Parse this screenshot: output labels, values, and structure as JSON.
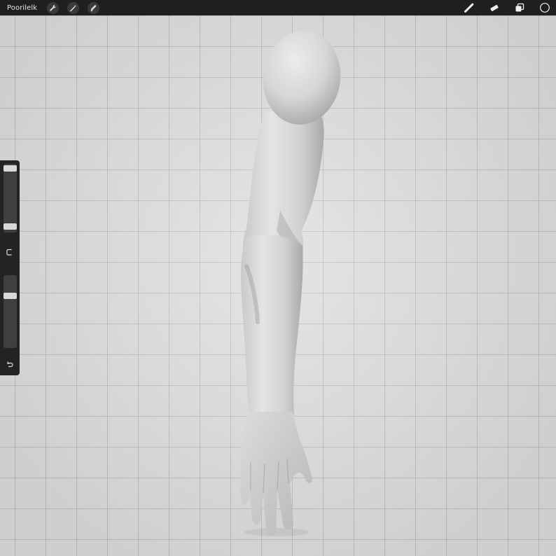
{
  "app": {
    "gallery_label": "Poorilelk"
  },
  "topbar": {
    "left_icons": [
      "wrench-icon",
      "magic-wand-icon",
      "selection-icon"
    ],
    "right_tools": [
      "brush-icon",
      "eraser-icon",
      "layers-icon",
      "color-icon"
    ]
  },
  "sidebar": {
    "brush_size_level": 0.15,
    "opacity_level": 0.25,
    "modify_icon": "modify-square-icon",
    "undo_icon": "undo-icon"
  },
  "colors": {
    "topbar": "#1f1f1f",
    "canvas": "#dcdcdc",
    "grid": "#a8a8a8",
    "sidebar": "#232323",
    "active_color": "#1f1f1f"
  }
}
